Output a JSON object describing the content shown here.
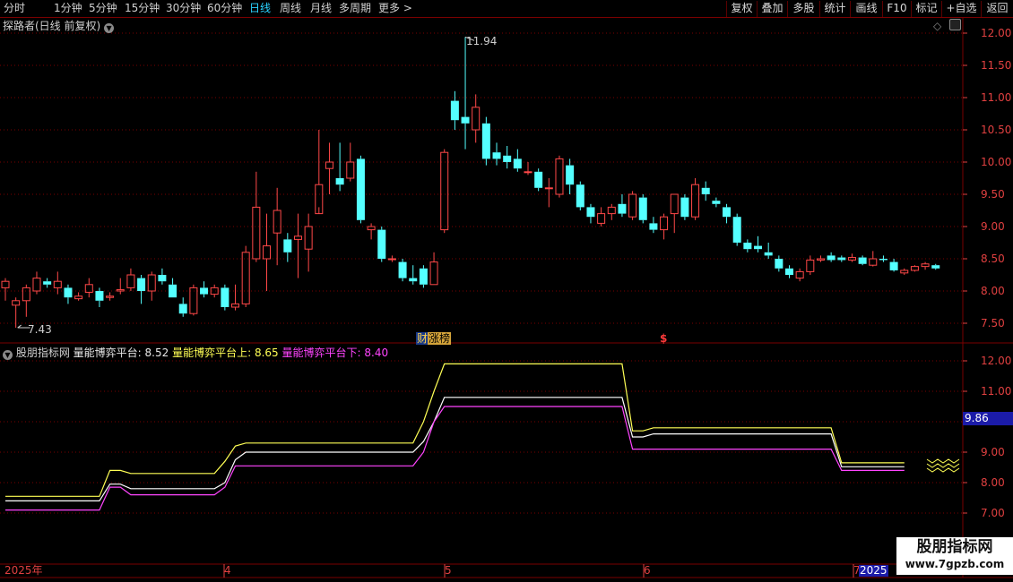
{
  "toolbar": {
    "periods": [
      "分时",
      "1分钟",
      "5分钟",
      "15分钟",
      "30分钟",
      "60分钟",
      "日线",
      "周线",
      "月线",
      "多周期",
      "更多 >"
    ],
    "active_period": "日线",
    "right_buttons": [
      "复权",
      "叠加",
      "多股",
      "统计",
      "画线",
      "F10",
      "标记",
      "+自选",
      "返回"
    ]
  },
  "main_panel": {
    "title": "探路者(日线 前复权)",
    "price_labels": [
      "12.00",
      "11.50",
      "11.00",
      "10.50",
      "10.00",
      "9.50",
      "9.00",
      "8.50",
      "8.00",
      "7.50"
    ],
    "high_marker": "11.94",
    "low_marker": "7.43",
    "tag_left": "财",
    "tag_right": "涨榜",
    "dollar_marker": "$"
  },
  "indicator_panel": {
    "name": "股朋指标网",
    "line1_label": "量能博弈平台:",
    "line1_value": "8.52",
    "line2_label": "量能博弈平台上:",
    "line2_value": "8.65",
    "line3_label": "量能博弈平台下:",
    "line3_value": "8.40",
    "price_labels": [
      "12.00",
      "11.00",
      "10.00",
      "9.00",
      "8.00",
      "7.00"
    ],
    "cursor_price": "9.86"
  },
  "date_axis": {
    "labels": [
      "2025年",
      "4",
      "5",
      "6",
      "7",
      "2025"
    ]
  },
  "watermark": {
    "line1": "股朋指标网",
    "line2": "www.7gpzb.com"
  },
  "colors": {
    "up": "#ff4848",
    "down": "#54ffff",
    "line_main": "#ffffff",
    "line_upper": "#ffff55",
    "line_lower": "#ff44ff",
    "grid": "#7a0000",
    "active": "#2ad3ff"
  },
  "chart_data": [
    {
      "type": "candlestick",
      "title": "探路者(日线 前复权)",
      "ylim": [
        7.3,
        12.2
      ],
      "candles": [
        [
          8.05,
          8.15,
          7.85,
          8.2
        ],
        [
          7.78,
          7.85,
          7.43,
          7.9
        ],
        [
          7.85,
          8.05,
          7.6,
          8.1
        ],
        [
          8.0,
          8.2,
          7.95,
          8.3
        ],
        [
          8.15,
          8.1,
          8.05,
          8.2
        ],
        [
          8.05,
          8.15,
          7.95,
          8.3
        ],
        [
          8.05,
          7.9,
          7.8,
          8.1
        ],
        [
          7.88,
          7.92,
          7.85,
          7.98
        ],
        [
          7.98,
          8.1,
          7.9,
          8.2
        ],
        [
          8.0,
          7.85,
          7.75,
          8.05
        ],
        [
          7.9,
          7.92,
          7.85,
          7.98
        ],
        [
          8.0,
          8.02,
          7.95,
          8.2
        ],
        [
          8.05,
          8.25,
          8.0,
          8.35
        ],
        [
          8.2,
          8.0,
          7.8,
          8.25
        ],
        [
          8.0,
          8.25,
          7.85,
          8.3
        ],
        [
          8.25,
          8.15,
          8.1,
          8.35
        ],
        [
          8.1,
          7.9,
          7.9,
          8.2
        ],
        [
          7.8,
          7.65,
          7.6,
          7.9
        ],
        [
          7.65,
          8.05,
          7.62,
          8.1
        ],
        [
          8.05,
          7.95,
          7.9,
          8.15
        ],
        [
          7.95,
          8.05,
          7.9,
          8.1
        ],
        [
          8.05,
          7.75,
          7.7,
          8.1
        ],
        [
          7.75,
          7.8,
          7.7,
          8.1
        ],
        [
          7.8,
          8.6,
          7.75,
          8.7
        ],
        [
          8.5,
          9.3,
          8.45,
          9.85
        ],
        [
          8.5,
          8.7,
          8.0,
          9.2
        ],
        [
          8.9,
          9.25,
          8.4,
          9.6
        ],
        [
          8.8,
          8.6,
          8.45,
          8.9
        ],
        [
          8.8,
          8.85,
          8.2,
          9.2
        ],
        [
          8.65,
          9.0,
          8.3,
          9.2
        ],
        [
          9.2,
          9.65,
          9.3,
          10.5
        ],
        [
          9.9,
          10.0,
          9.5,
          10.3
        ],
        [
          9.75,
          9.65,
          9.55,
          10.3
        ],
        [
          9.75,
          10.0,
          9.7,
          10.3
        ],
        [
          10.05,
          9.1,
          9.05,
          10.1
        ],
        [
          8.95,
          9.0,
          8.8,
          9.05
        ],
        [
          8.95,
          8.5,
          8.45,
          9.0
        ],
        [
          8.5,
          8.5,
          8.45,
          8.55
        ],
        [
          8.45,
          8.2,
          8.15,
          8.5
        ],
        [
          8.2,
          8.15,
          8.1,
          8.4
        ],
        [
          8.35,
          8.1,
          8.05,
          8.4
        ],
        [
          8.1,
          8.45,
          8.1,
          8.6
        ],
        [
          8.95,
          10.15,
          8.9,
          10.2
        ],
        [
          10.95,
          10.65,
          10.5,
          11.1
        ],
        [
          10.7,
          10.6,
          10.2,
          11.94
        ],
        [
          10.5,
          10.85,
          10.3,
          11.05
        ],
        [
          10.6,
          10.05,
          9.95,
          10.7
        ],
        [
          10.15,
          10.05,
          9.95,
          10.3
        ],
        [
          10.1,
          10.0,
          9.9,
          10.25
        ],
        [
          10.05,
          9.9,
          9.85,
          10.2
        ],
        [
          9.85,
          9.85,
          9.8,
          10.0
        ],
        [
          9.85,
          9.6,
          9.55,
          9.9
        ],
        [
          9.6,
          9.6,
          9.3,
          9.75
        ],
        [
          9.5,
          10.05,
          9.45,
          10.1
        ],
        [
          9.95,
          9.65,
          9.5,
          10.05
        ],
        [
          9.65,
          9.3,
          9.25,
          9.7
        ],
        [
          9.3,
          9.15,
          9.05,
          9.35
        ],
        [
          9.05,
          9.2,
          9.0,
          9.3
        ],
        [
          9.2,
          9.3,
          9.1,
          9.35
        ],
        [
          9.35,
          9.2,
          9.15,
          9.5
        ],
        [
          9.15,
          9.5,
          9.1,
          9.55
        ],
        [
          9.45,
          9.1,
          9.05,
          9.5
        ],
        [
          9.05,
          8.95,
          8.9,
          9.15
        ],
        [
          8.95,
          9.15,
          8.8,
          9.2
        ],
        [
          9.2,
          9.5,
          8.9,
          9.5
        ],
        [
          9.45,
          9.15,
          9.1,
          9.5
        ],
        [
          9.15,
          9.65,
          9.1,
          9.75
        ],
        [
          9.6,
          9.5,
          9.4,
          9.7
        ],
        [
          9.4,
          9.35,
          9.3,
          9.45
        ],
        [
          9.3,
          9.15,
          9.05,
          9.35
        ],
        [
          9.15,
          8.75,
          8.7,
          9.2
        ],
        [
          8.75,
          8.65,
          8.6,
          8.8
        ],
        [
          8.7,
          8.65,
          8.6,
          8.85
        ],
        [
          8.6,
          8.55,
          8.5,
          8.75
        ],
        [
          8.5,
          8.35,
          8.3,
          8.55
        ],
        [
          8.35,
          8.25,
          8.2,
          8.4
        ],
        [
          8.2,
          8.3,
          8.15,
          8.35
        ],
        [
          8.3,
          8.48,
          8.25,
          8.55
        ],
        [
          8.48,
          8.5,
          8.45,
          8.55
        ],
        [
          8.55,
          8.48,
          8.45,
          8.6
        ],
        [
          8.52,
          8.48,
          8.45,
          8.55
        ],
        [
          8.48,
          8.52,
          8.45,
          8.58
        ],
        [
          8.52,
          8.42,
          8.4,
          8.55
        ],
        [
          8.4,
          8.5,
          8.38,
          8.62
        ],
        [
          8.5,
          8.48,
          8.45,
          8.55
        ],
        [
          8.45,
          8.32,
          8.3,
          8.5
        ],
        [
          8.28,
          8.32,
          8.25,
          8.35
        ],
        [
          8.32,
          8.38,
          8.3,
          8.4
        ],
        [
          8.38,
          8.42,
          8.33,
          8.45
        ],
        [
          8.4,
          8.35,
          8.33,
          8.42
        ]
      ]
    },
    {
      "type": "line",
      "title": "股朋指标网",
      "ylim": [
        6.7,
        12.4
      ],
      "series": [
        {
          "name": "量能博弈平台",
          "points": [
            [
              0,
              7.4
            ],
            [
              9,
              7.4
            ],
            [
              10,
              7.95
            ],
            [
              11,
              7.95
            ],
            [
              12,
              7.8
            ],
            [
              20,
              7.8
            ],
            [
              21,
              8.0
            ],
            [
              22,
              8.75
            ],
            [
              23,
              9.0
            ],
            [
              39,
              9.0
            ],
            [
              40,
              9.35
            ],
            [
              41,
              10.0
            ],
            [
              42,
              10.8
            ],
            [
              59,
              10.8
            ],
            [
              60,
              9.5
            ],
            [
              61,
              9.5
            ],
            [
              62,
              9.6
            ],
            [
              79,
              9.6
            ],
            [
              80,
              8.52
            ],
            [
              86,
              8.52
            ]
          ]
        },
        {
          "name": "量能博弈平台上",
          "points": [
            [
              0,
              7.55
            ],
            [
              9,
              7.55
            ],
            [
              10,
              8.4
            ],
            [
              11,
              8.4
            ],
            [
              12,
              8.3
            ],
            [
              20,
              8.3
            ],
            [
              21,
              8.7
            ],
            [
              22,
              9.2
            ],
            [
              23,
              9.3
            ],
            [
              39,
              9.3
            ],
            [
              40,
              10.0
            ],
            [
              41,
              11.0
            ],
            [
              42,
              11.9
            ],
            [
              59,
              11.9
            ],
            [
              60,
              9.7
            ],
            [
              61,
              9.7
            ],
            [
              62,
              9.8
            ],
            [
              79,
              9.8
            ],
            [
              80,
              8.65
            ],
            [
              86,
              8.65
            ]
          ]
        },
        {
          "name": "量能博弈平台下",
          "points": [
            [
              0,
              7.1
            ],
            [
              9,
              7.1
            ],
            [
              10,
              7.85
            ],
            [
              11,
              7.85
            ],
            [
              12,
              7.6
            ],
            [
              20,
              7.6
            ],
            [
              21,
              7.85
            ],
            [
              22,
              8.55
            ],
            [
              23,
              8.55
            ],
            [
              39,
              8.55
            ],
            [
              40,
              9.0
            ],
            [
              41,
              10.0
            ],
            [
              42,
              10.5
            ],
            [
              59,
              10.5
            ],
            [
              60,
              9.1
            ],
            [
              61,
              9.1
            ],
            [
              62,
              9.1
            ],
            [
              79,
              9.1
            ],
            [
              80,
              8.4
            ],
            [
              86,
              8.4
            ]
          ]
        }
      ]
    }
  ]
}
